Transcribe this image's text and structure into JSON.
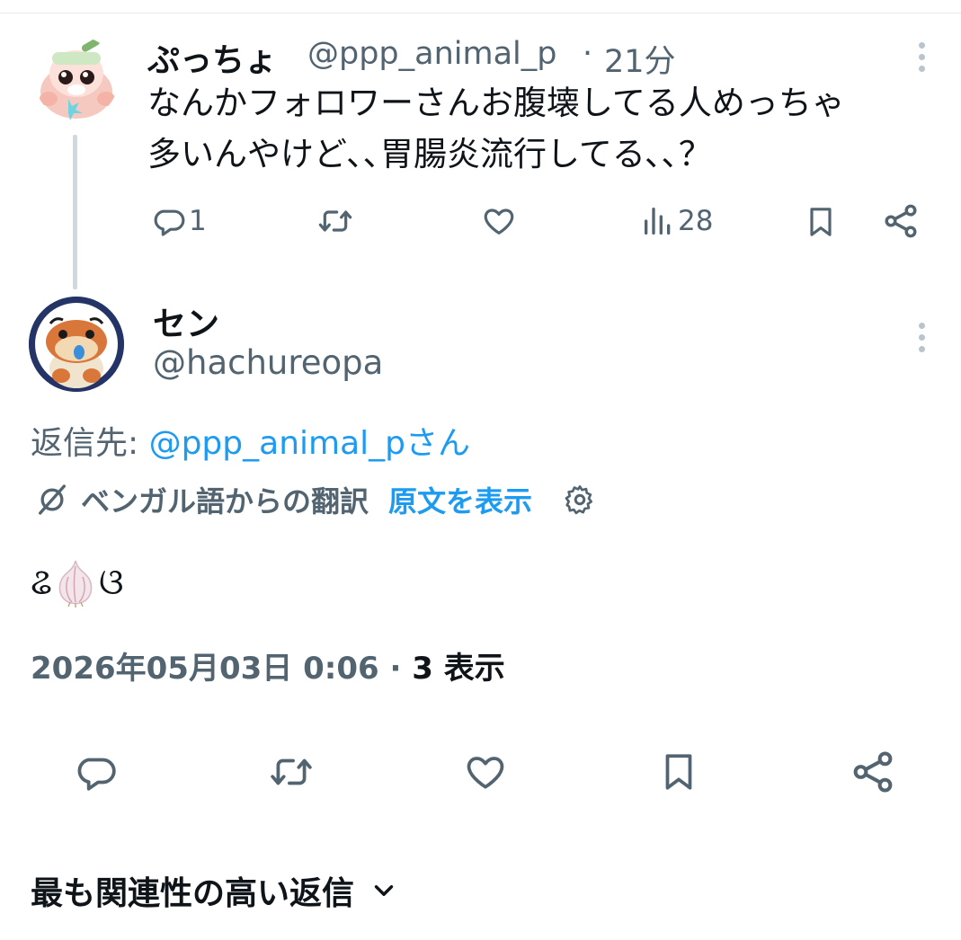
{
  "parent": {
    "display_name": "ぷっちょ",
    "handle": "@ppp_animal_p",
    "separator": "·",
    "time": "21分",
    "text_lines": [
      "なんかフォロワーさんお腹壊してる人めっちゃ",
      "多いんやけど､､胃腸炎流行してる､､？"
    ],
    "reply_count": "1",
    "retweet_count": "",
    "like_count": "",
    "view_count": "28"
  },
  "reply": {
    "display_name": "セン",
    "handle": "@hachureopa",
    "reply_to_prefix": "返信先: ",
    "reply_to_mention": "@ppp_animal_pさん",
    "translation_label": "ベンガル語からの翻訳",
    "show_original": "原文を表示",
    "text_left": "ଌ",
    "text_right": "ଓ",
    "emoji": "garlic",
    "date": "2026年05月03日 0:06",
    "meta_separator": " · ",
    "views": "3 表示"
  },
  "icons": {
    "reply": "reply-icon",
    "retweet": "retweet-icon",
    "like": "like-icon",
    "views": "views-icon",
    "bookmark": "bookmark-icon",
    "share": "share-icon",
    "more": "more-icon",
    "translate": "translate-icon",
    "settings": "gear-icon",
    "chevron": "chevron-down-icon"
  },
  "sort_filter": {
    "label": "最も関連性の高い返信"
  },
  "colors": {
    "accent": "#1d9bf0",
    "secondary_text": "#536471",
    "primary_text": "#0f1419"
  }
}
